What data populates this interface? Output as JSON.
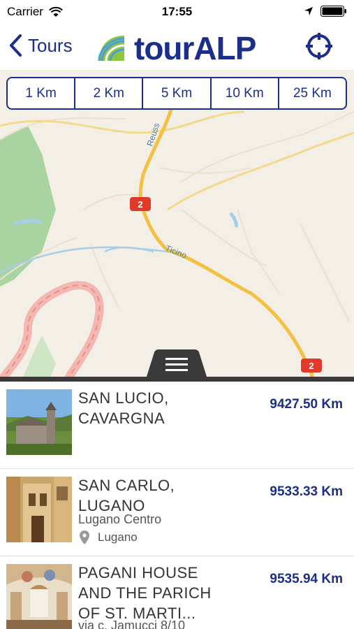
{
  "status_bar": {
    "carrier": "Carrier",
    "time": "17:55"
  },
  "nav": {
    "back_label": "Tours",
    "brand": "tourALP"
  },
  "distance_options": [
    "1 Km",
    "2 Km",
    "5 Km",
    "10 Km",
    "25 Km"
  ],
  "map": {
    "labels": {
      "river1": "Reuss",
      "river2": "Ticino",
      "road_badge_1": "2",
      "road_badge_2": "2"
    }
  },
  "list": {
    "items": [
      {
        "title": "SAN LUCIO, CAVARGNA",
        "distance": "9427.50 Km"
      },
      {
        "title": "SAN CARLO, LUGANO",
        "distance": "9533.33 Km",
        "subtitle": "Lugano Centro",
        "location": "Lugano"
      },
      {
        "title": "PAGANI HOUSE AND THE PARICH OF ST. MARTI...",
        "distance": "9535.94 Km",
        "subtitle": "via c. Jamucci 8/10"
      }
    ]
  }
}
